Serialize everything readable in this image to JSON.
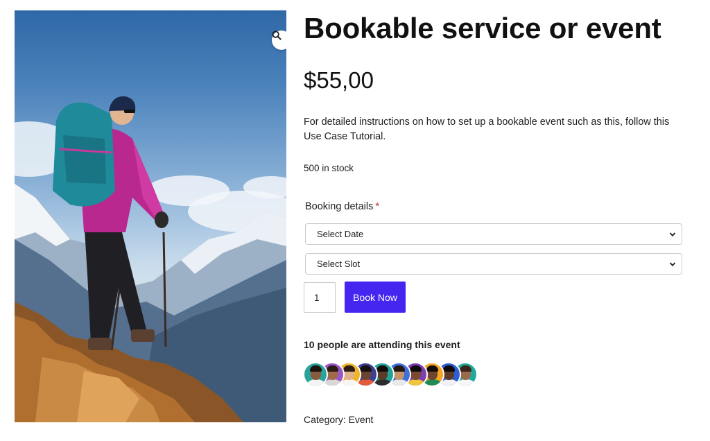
{
  "product": {
    "title": "Bookable service or event",
    "price": "$55,00",
    "description": "For detailed instructions on how to set up a bookable event such as this, follow this Use Case Tutorial.",
    "stock": "500 in stock",
    "image_icon": "zoom-magnifier-icon"
  },
  "booking": {
    "label": "Booking details",
    "required_mark": "*",
    "date_select": "Select Date",
    "slot_select": "Select Slot",
    "quantity": "1",
    "book_button": "Book Now",
    "accent_color": "#4426f0"
  },
  "attendees": {
    "heading": "10 people are attending this event",
    "avatars": [
      {
        "bg": "#2aa39a",
        "skin": "#8a5a3c",
        "hair": "#1d1410",
        "shirt": "#f4f4f4"
      },
      {
        "bg": "#9a56c4",
        "skin": "#a06a46",
        "hair": "#2a1a12",
        "shirt": "#d7d7d7"
      },
      {
        "bg": "#f0b429",
        "skin": "#e0b08a",
        "hair": "#2b1d15",
        "shirt": "#f6f6f6"
      },
      {
        "bg": "#3d3f8f",
        "skin": "#6b4430",
        "hair": "#161010",
        "shirt": "#e65a3a"
      },
      {
        "bg": "#22a39a",
        "skin": "#5b3a28",
        "hair": "#120d0b",
        "shirt": "#2c2c2c"
      },
      {
        "bg": "#3f6fd8",
        "skin": "#c8946a",
        "hair": "#24170f",
        "shirt": "#e9e9e9"
      },
      {
        "bg": "#7d3fb0",
        "skin": "#7a4b31",
        "hair": "#0f0b09",
        "shirt": "#f0c53a"
      },
      {
        "bg": "#f5a623",
        "skin": "#6d4530",
        "hair": "#130d0a",
        "shirt": "#1f8c57"
      },
      {
        "bg": "#2d5fd0",
        "skin": "#5e3b29",
        "hair": "#0f0a08",
        "shirt": "#f2f2f2"
      },
      {
        "bg": "#23a99c",
        "skin": "#9a6a4b",
        "hair": "#3a2418",
        "shirt": "#f7f7f7"
      }
    ]
  },
  "meta": {
    "category_label": "Category:",
    "category_value": "Event"
  }
}
